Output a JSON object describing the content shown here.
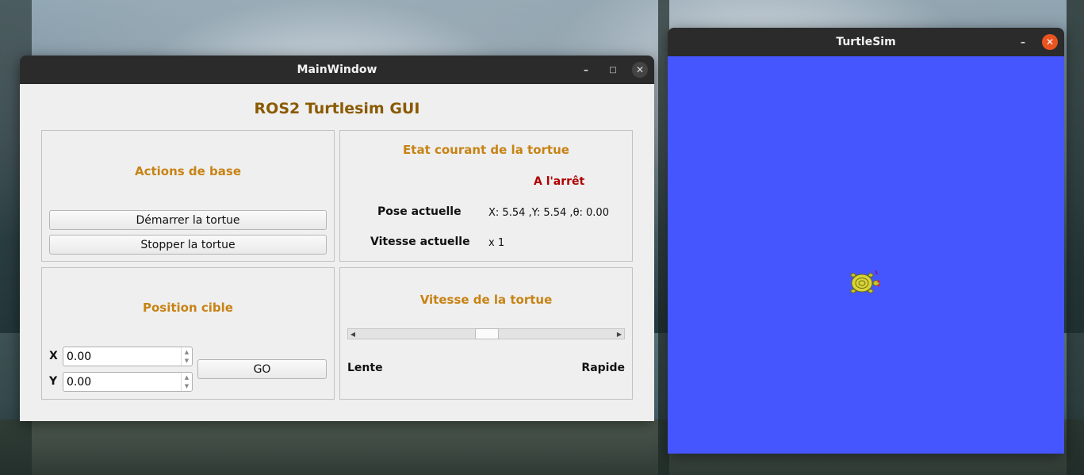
{
  "main_window": {
    "title": "MainWindow",
    "minimize": "–",
    "maximize": "□",
    "close": "✕",
    "app_title": "ROS2 Turtlesim GUI",
    "actions": {
      "title": "Actions de base",
      "start_label": "Démarrer la tortue",
      "stop_label": "Stopper la tortue"
    },
    "state": {
      "title": "Etat courant de la tortue",
      "status": "A l'arrêt",
      "pose_label": "Pose actuelle",
      "pose_value": "X: 5.54 ,Y: 5.54 ,θ: 0.00",
      "speed_label": "Vitesse actuelle",
      "speed_value": "x 1"
    },
    "target": {
      "title": "Position cible",
      "x_label": "X",
      "x_value": "0.00",
      "y_label": "Y",
      "y_value": "0.00",
      "go_label": "GO"
    },
    "speed": {
      "title": "Vitesse de la tortue",
      "slow_label": "Lente",
      "fast_label": "Rapide",
      "slider_fraction": 0.5
    }
  },
  "turtlesim": {
    "title": "TurtleSim",
    "minimize": "–",
    "close": "✕",
    "background_color": "#4556ff"
  },
  "colors": {
    "section_title": "#c78314",
    "app_title": "#8a5a00",
    "status": "#b00000",
    "close_button": "#e95420"
  }
}
